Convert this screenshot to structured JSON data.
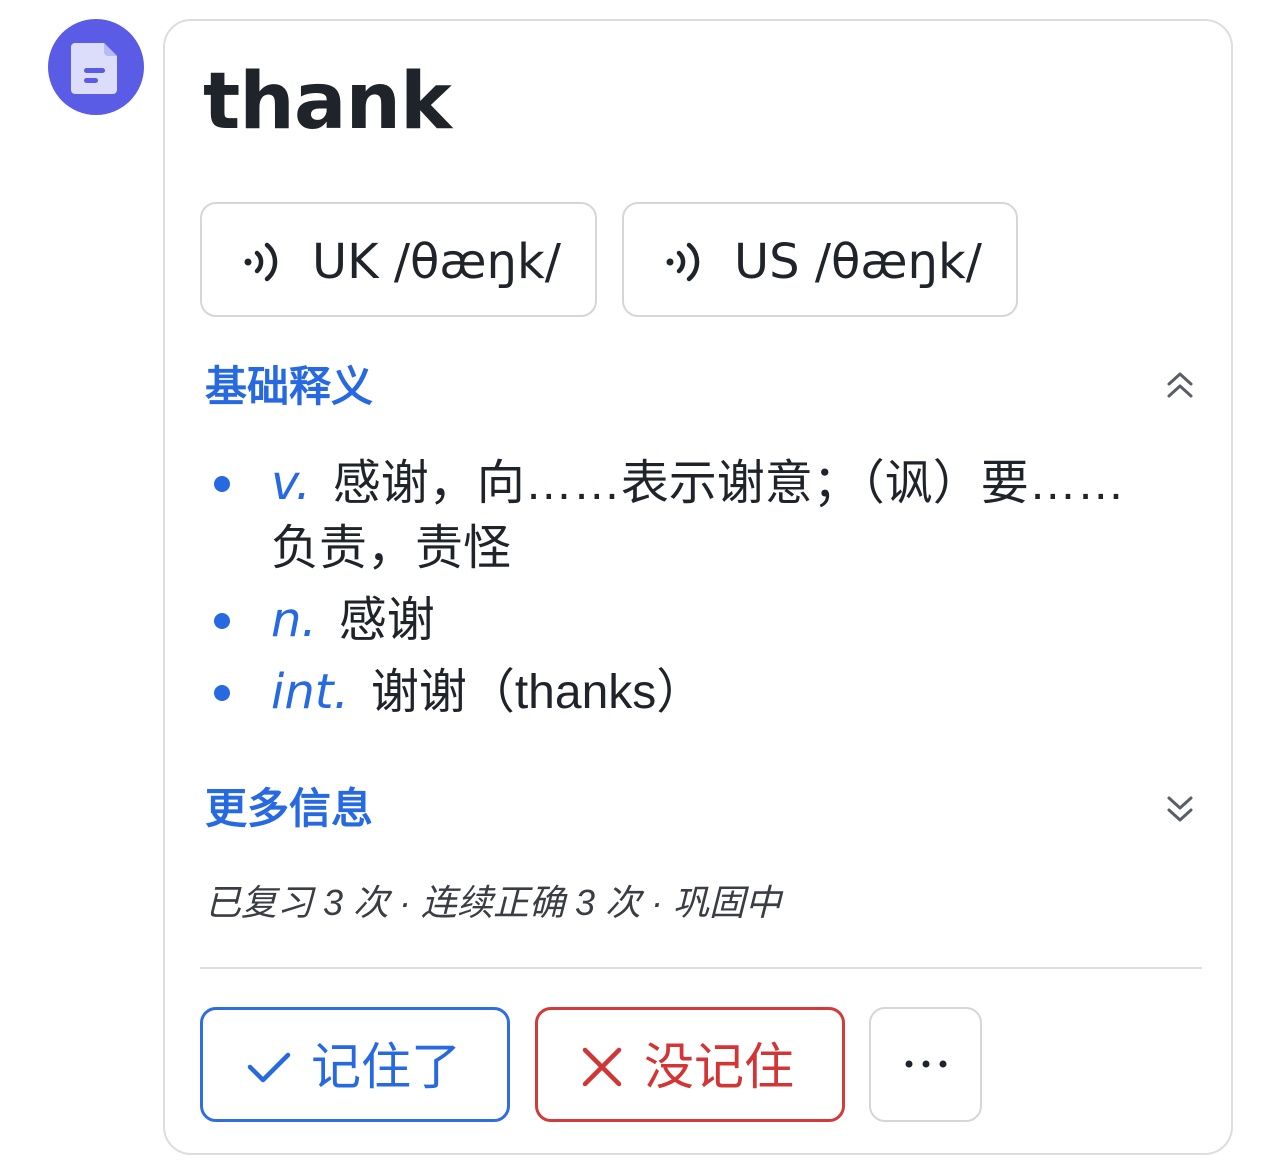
{
  "word": "thank",
  "pronunciations": [
    {
      "region": "UK",
      "ipa": "UK /θæŋk/"
    },
    {
      "region": "US",
      "ipa": "US /θæŋk/"
    }
  ],
  "sections": {
    "basic_title": "基础释义",
    "more_title": "更多信息"
  },
  "definitions": [
    {
      "pos": "v.",
      "text": "感谢，向……表示谢意；（讽）要……负责，责怪"
    },
    {
      "pos": "n.",
      "text": "感谢"
    },
    {
      "pos": "int.",
      "text": "谢谢（thanks）"
    }
  ],
  "review_status": "已复习 3 次 · 连续正确 3 次 · 巩固中",
  "actions": {
    "remember": "记住了",
    "forgot": "没记住",
    "more": "···"
  },
  "colors": {
    "accent": "#2769e0",
    "danger": "#d33434",
    "avatar": "#5b5ce6",
    "text": "#1f232a"
  },
  "icons": {
    "avatar": "document-icon",
    "audio": "speaker-wave-icon",
    "collapse": "double-chevron-up-icon",
    "expand": "double-chevron-down-icon",
    "remember": "check-icon",
    "forgot": "x-icon",
    "more": "ellipsis-icon"
  }
}
